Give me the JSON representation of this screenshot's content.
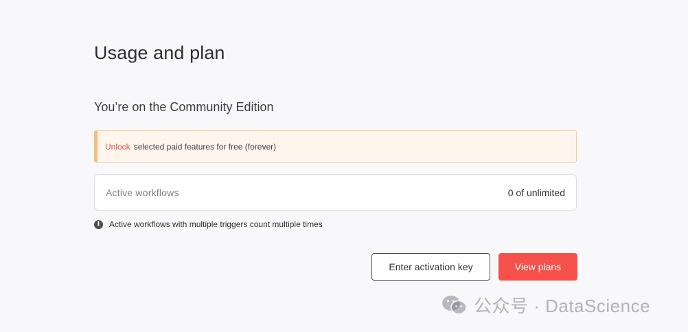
{
  "page": {
    "title": "Usage and plan"
  },
  "edition": {
    "title": "You’re on the Community Edition"
  },
  "banner": {
    "link_label": "Unlock",
    "text": "selected paid features for free (forever)"
  },
  "usage": {
    "label": "Active workflows",
    "value": "0 of unlimited"
  },
  "info": {
    "icon": "info-icon",
    "text": "Active workflows with multiple triggers count multiple times"
  },
  "actions": {
    "activation_label": "Enter activation key",
    "view_plans_label": "View plans"
  },
  "watermark": {
    "icon": "wechat-icon",
    "text": "公众号 · DataScience"
  },
  "colors": {
    "accent": "#f6504b",
    "banner_bg": "#fef5ec",
    "banner_border": "#f5bf7b",
    "page_bg": "#f8f8fb"
  }
}
